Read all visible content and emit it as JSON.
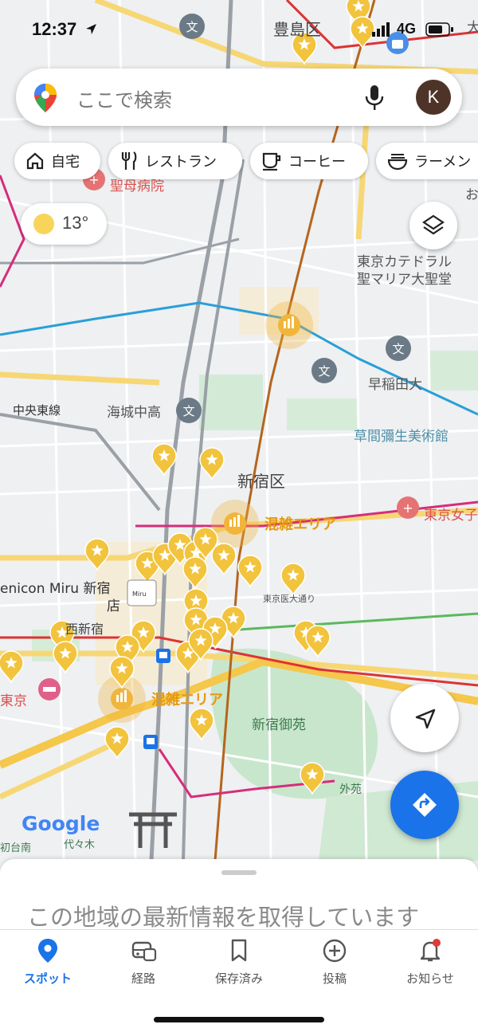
{
  "status": {
    "time": "12:37",
    "network": "4G"
  },
  "search": {
    "placeholder": "ここで検索",
    "avatar_initial": "K"
  },
  "chips": [
    {
      "label": "自宅",
      "icon": "home-icon"
    },
    {
      "label": "レストラン",
      "icon": "restaurant-icon"
    },
    {
      "label": "コーヒー",
      "icon": "coffee-icon"
    },
    {
      "label": "ラーメン",
      "icon": "ramen-icon"
    }
  ],
  "weather": {
    "temp": "13°",
    "icon": "sun-icon"
  },
  "map": {
    "labels": {
      "toshima": "豊島区",
      "seibo": "聖母病院",
      "cathedral_1": "東京カテドラル",
      "cathedral_2": "聖マリア大聖堂",
      "waseda": "早稲田大",
      "kaijo": "海城中高",
      "chuo_line": "中央東線",
      "kusama": "草間彌生美術館",
      "shinjuku_ku": "新宿区",
      "crowd_1": "混雑エリア",
      "crowd_2": "混雑エリア",
      "tokyo_women": "東京女子",
      "menicon_1": "enicon Miru 新宿",
      "menicon_2": "店",
      "nishi_shinjuku": "西新宿",
      "tokyo": "東京",
      "tokyo_idai": "東京医大通り",
      "gyoen": "新宿御苑",
      "gaien": "外苑",
      "google": "Google",
      "hatsudai": "初台南",
      "yoyogi": "代々木",
      "oo": "お",
      "dai": "大",
      "miru_sign": "Miru"
    }
  },
  "sheet": {
    "message": "この地域の最新情報を取得しています"
  },
  "nav": [
    {
      "label": "スポット",
      "icon": "location-pin-icon",
      "active": true
    },
    {
      "label": "経路",
      "icon": "commute-icon",
      "active": false
    },
    {
      "label": "保存済み",
      "icon": "bookmark-icon",
      "active": false
    },
    {
      "label": "投稿",
      "icon": "add-circle-icon",
      "active": false
    },
    {
      "label": "お知らせ",
      "icon": "bell-icon",
      "active": false
    }
  ],
  "colors": {
    "accent": "#1a73e8",
    "star": "#f2c33c",
    "crowd": "#f1b53b",
    "avatar": "#4e3428",
    "notification_dot": "#e53935"
  }
}
